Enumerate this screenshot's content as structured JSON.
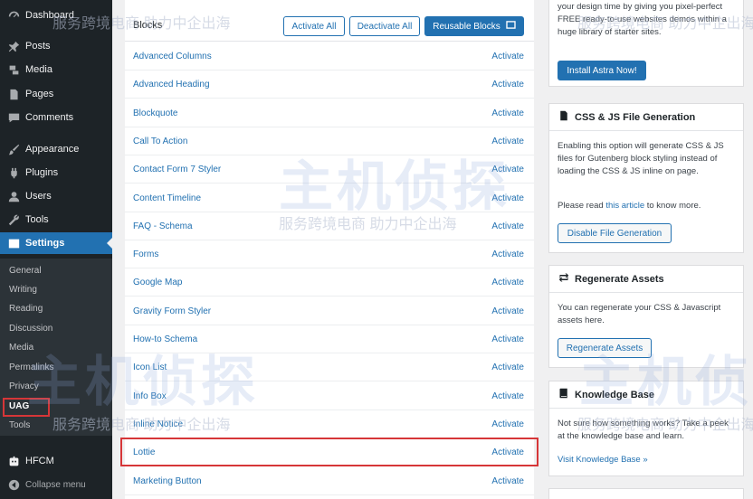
{
  "sidebar": {
    "items": [
      {
        "label": "Dashboard",
        "icon": "dashboard-icon"
      },
      {
        "label": "Posts",
        "icon": "pin-icon"
      },
      {
        "label": "Media",
        "icon": "media-icon"
      },
      {
        "label": "Pages",
        "icon": "pages-icon"
      },
      {
        "label": "Comments",
        "icon": "comment-icon"
      },
      {
        "label": "Appearance",
        "icon": "brush-icon"
      },
      {
        "label": "Plugins",
        "icon": "plugin-icon"
      },
      {
        "label": "Users",
        "icon": "user-icon"
      },
      {
        "label": "Tools",
        "icon": "wrench-icon"
      },
      {
        "label": "Settings",
        "icon": "settings-icon"
      }
    ],
    "submenu": [
      "General",
      "Writing",
      "Reading",
      "Discussion",
      "Media",
      "Permalinks",
      "Privacy",
      "UAG",
      "Tools"
    ],
    "hfcm": "HFCM",
    "collapse": "Collapse menu"
  },
  "blocks": {
    "title": "Blocks",
    "activate_all": "Activate All",
    "deactivate_all": "Deactivate All",
    "reusable_blocks": "Reusable Blocks",
    "activate_label": "Activate",
    "items": [
      "Advanced Columns",
      "Advanced Heading",
      "Blockquote",
      "Call To Action",
      "Contact Form 7 Styler",
      "Content Timeline",
      "FAQ - Schema",
      "Forms",
      "Google Map",
      "Gravity Form Styler",
      "How-to Schema",
      "Icon List",
      "Info Box",
      "Inline Notice",
      "Lottie",
      "Marketing Button"
    ]
  },
  "astra": {
    "text": "your design time by giving you pixel-perfect FREE ready-to-use websites demos within a huge library of starter sites.",
    "button": "Install Astra Now!"
  },
  "css_js": {
    "title": "CSS & JS File Generation",
    "text": "Enabling this option will generate CSS & JS files for Gutenberg block styling instead of loading the CSS & JS inline on page.",
    "read_prefix": "Please read ",
    "read_link": "this article",
    "read_suffix": " to know more.",
    "button": "Disable File Generation"
  },
  "regenerate": {
    "title": "Regenerate Assets",
    "text": "You can regenerate your CSS & Javascript assets here.",
    "button": "Regenerate Assets"
  },
  "knowledge": {
    "title": "Knowledge Base",
    "text": "Not sure how something works? Take a peek at the knowledge base and learn.",
    "link": "Visit Knowledge Base »"
  },
  "watermark": {
    "small": "服务跨境电商 助力中企出海",
    "big": "主机侦探"
  }
}
